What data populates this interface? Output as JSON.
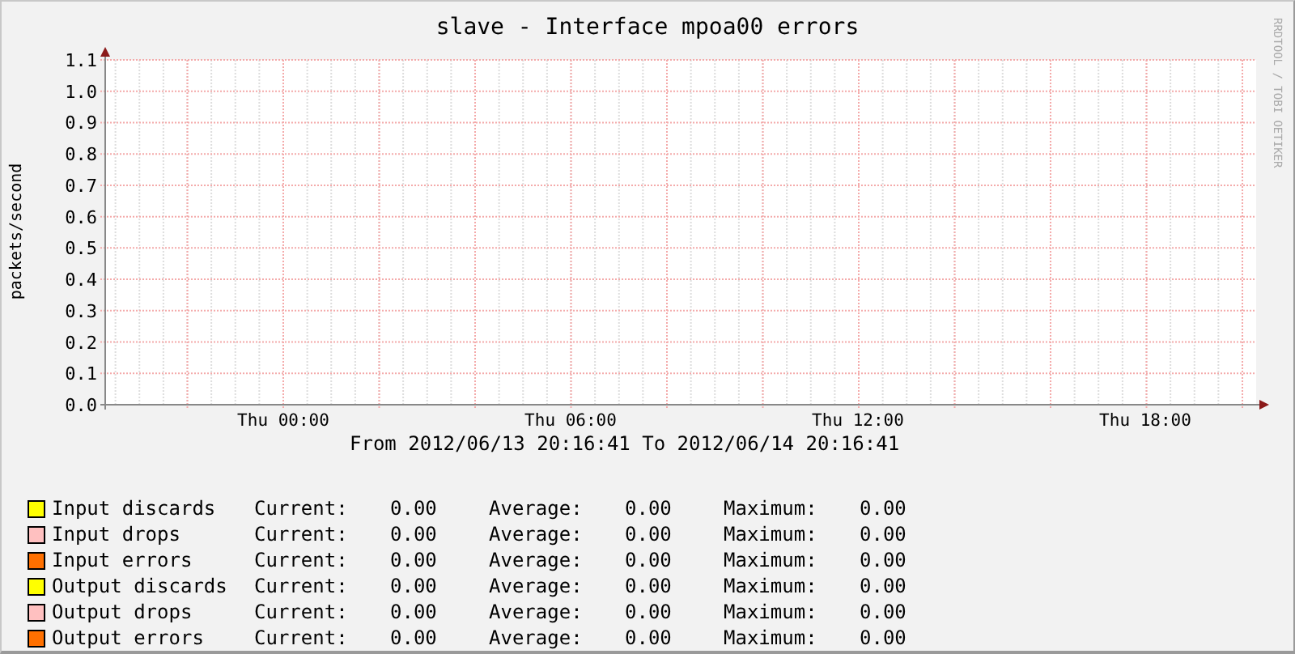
{
  "chart": {
    "credit": "RRDTOOL / TOBI OETIKER",
    "chart_data": {
      "type": "line",
      "grid": true,
      "categories": [
        "Thu 00:00",
        "Thu 06:00",
        "Thu 12:00",
        "Thu 18:00"
      ],
      "title": "slave - Interface mpoa00 errors",
      "ylabel": "packets/second",
      "ylim": [
        0,
        1.1
      ],
      "yticks": [
        {
          "value": 0,
          "label": "0.0"
        },
        {
          "value": 0.1,
          "label": "0.1"
        },
        {
          "value": 0.2,
          "label": "0.2"
        },
        {
          "value": 0.3,
          "label": "0.3"
        },
        {
          "value": 0.4,
          "label": "0.4"
        },
        {
          "value": 0.5,
          "label": "0.5"
        },
        {
          "value": 0.6,
          "label": "0.6"
        },
        {
          "value": 0.7,
          "label": "0.7"
        },
        {
          "value": 0.8,
          "label": "0.8"
        },
        {
          "value": 0.9,
          "label": "0.9"
        },
        {
          "value": 1.0,
          "label": "1.0"
        },
        {
          "value": 1.1,
          "label": "1.1"
        }
      ]
    }
  },
  "period": "From 2012/06/13 20:16:41 To 2012/06/14 20:16:41",
  "legend": [
    {
      "name": "Input discards",
      "color": "#ffff00",
      "current_label": "Current:",
      "current": "0.00",
      "average_label": "Average:",
      "average": "0.00",
      "maximum_label": "Maximum:",
      "maximum": "0.00"
    },
    {
      "name": "Input drops",
      "color": "#ffc0c0",
      "current_label": "Current:",
      "current": "0.00",
      "average_label": "Average:",
      "average": "0.00",
      "maximum_label": "Maximum:",
      "maximum": "0.00"
    },
    {
      "name": "Input errors",
      "color": "#ff7000",
      "current_label": "Current:",
      "current": "0.00",
      "average_label": "Average:",
      "average": "0.00",
      "maximum_label": "Maximum:",
      "maximum": "0.00"
    },
    {
      "name": "Output discards",
      "color": "#ffff00",
      "current_label": "Current:",
      "current": "0.00",
      "average_label": "Average:",
      "average": "0.00",
      "maximum_label": "Maximum:",
      "maximum": "0.00"
    },
    {
      "name": "Output drops",
      "color": "#ffc0c0",
      "current_label": "Current:",
      "current": "0.00",
      "average_label": "Average:",
      "average": "0.00",
      "maximum_label": "Maximum:",
      "maximum": "0.00"
    },
    {
      "name": "Output errors",
      "color": "#ff7000",
      "current_label": "Current:",
      "current": "0.00",
      "average_label": "Average:",
      "average": "0.00",
      "maximum_label": "Maximum:",
      "maximum": "0.00"
    }
  ]
}
